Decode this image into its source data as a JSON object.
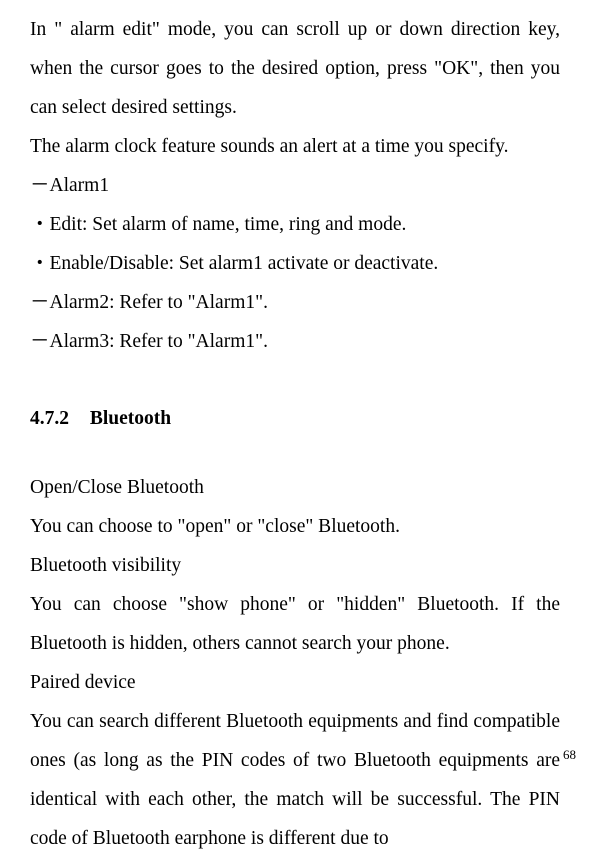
{
  "paragraphs": {
    "p1": "In \" alarm edit\" mode,   you can scroll up or down direction key, when the cursor goes to the desired option, press \"OK\", then you can select desired settings.",
    "p2": "The alarm clock feature sounds an alert at a time you specify.",
    "p3": "－Alarm1",
    "p4": "・Edit: Set alarm of name, time, ring and mode.",
    "p5": "・Enable/Disable: Set alarm1 activate or deactivate.",
    "p6": "－Alarm2: Refer to \"Alarm1\".",
    "p7": "－Alarm3: Refer to \"Alarm1\"."
  },
  "heading": {
    "number": "4.7.2",
    "title": "Bluetooth"
  },
  "section": {
    "s1": "Open/Close Bluetooth",
    "s2": "You can choose to \"open\" or \"close\" Bluetooth.",
    "s3": "Bluetooth visibility",
    "s4": "You can choose \"show phone\" or \"hidden\" Bluetooth. If the Bluetooth is hidden, others cannot search your phone.",
    "s5": "Paired device",
    "s6": "You can search different Bluetooth equipments and find compatible ones (as long as the PIN codes of two Bluetooth equipments are identical with each other, the match will be successful. The PIN code of Bluetooth earphone is different due to"
  },
  "page_number": "68"
}
